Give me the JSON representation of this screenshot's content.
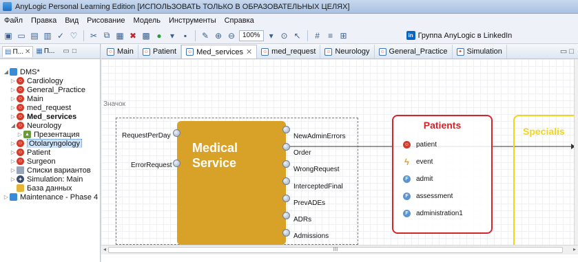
{
  "window": {
    "title": "AnyLogic Personal Learning Edition [ИСПОЛЬЗОВАТЬ ТОЛЬКО В ОБРАЗОВАТЕЛЬНЫХ ЦЕЛЯХ]"
  },
  "menu": [
    "Файл",
    "Правка",
    "Вид",
    "Рисование",
    "Модель",
    "Инструменты",
    "Справка"
  ],
  "toolbar": {
    "zoom": "100%",
    "linkedin_label": "Группа AnyLogic в LinkedIn"
  },
  "left_panel": {
    "tabs": [
      "П...",
      "П..."
    ],
    "tree": [
      {
        "label": "DMS*",
        "level": 0,
        "icon": "model-icon",
        "expanded": true
      },
      {
        "label": "Cardiology",
        "level": 1,
        "icon": "agent-icon"
      },
      {
        "label": "General_Practice",
        "level": 1,
        "icon": "agent-icon"
      },
      {
        "label": "Main",
        "level": 1,
        "icon": "agent-icon"
      },
      {
        "label": "med_request",
        "level": 1,
        "icon": "agent-icon"
      },
      {
        "label": "Med_services",
        "level": 1,
        "icon": "agent-icon",
        "bold": true
      },
      {
        "label": "Neurology",
        "level": 1,
        "icon": "agent-icon",
        "expanded": true
      },
      {
        "label": "Презентация",
        "level": 2,
        "icon": "presentation-icon"
      },
      {
        "label": "Otolaryngology",
        "level": 1,
        "icon": "agent-icon",
        "selected": true
      },
      {
        "label": "Patient",
        "level": 1,
        "icon": "agent-icon"
      },
      {
        "label": "Surgeon",
        "level": 1,
        "icon": "agent-icon"
      },
      {
        "label": "Списки вариантов",
        "level": 1,
        "icon": "list-icon"
      },
      {
        "label": "Simulation: Main",
        "level": 1,
        "icon": "simulation-icon"
      },
      {
        "label": "База данных",
        "level": 1,
        "icon": "database-icon"
      },
      {
        "label": "Maintenance - Phase 4",
        "level": 0,
        "icon": "model-icon"
      }
    ]
  },
  "editor": {
    "tabs": [
      {
        "label": "Main",
        "active": false
      },
      {
        "label": "Patient",
        "active": false
      },
      {
        "label": "Med_services",
        "active": true
      },
      {
        "label": "med_request",
        "active": false
      },
      {
        "label": "Neurology",
        "active": false
      },
      {
        "label": "General_Practice",
        "active": false
      },
      {
        "label": "Simulation",
        "active": false
      }
    ],
    "canvas": {
      "icon_area_label": "Значок",
      "block_title_1": "Medical",
      "block_title_2": "Service",
      "input_ports": [
        "RequestPerDay",
        "ErrorRequest"
      ],
      "output_ports": [
        "NewAdminErrors",
        "Order",
        "WrongRequest",
        "InterceptedFinal",
        "PrevADEs",
        "ADRs",
        "Admissions"
      ],
      "patients": {
        "title": "Patients",
        "items": [
          {
            "label": "patient",
            "icon": "agent-icon"
          },
          {
            "label": "event",
            "icon": "event-icon"
          },
          {
            "label": "admit",
            "icon": "function-icon"
          },
          {
            "label": "assessment",
            "icon": "function-icon"
          },
          {
            "label": "administration1",
            "icon": "function-icon"
          }
        ]
      },
      "specialists_title": "Specialis"
    },
    "scroll_mark": "III"
  }
}
